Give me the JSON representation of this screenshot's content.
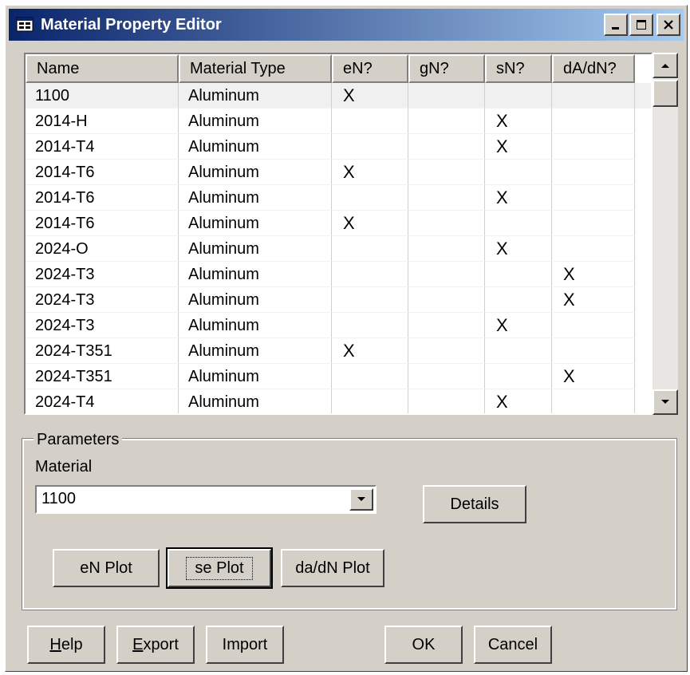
{
  "window": {
    "title": "Material Property Editor"
  },
  "table": {
    "columns": [
      "Name",
      "Material Type",
      "eN?",
      "gN?",
      "sN?",
      "dA/dN?"
    ],
    "rows": [
      [
        "1100",
        "Aluminum",
        "X",
        "",
        "",
        ""
      ],
      [
        "2014-H",
        "Aluminum",
        "",
        "",
        "X",
        ""
      ],
      [
        "2014-T4",
        "Aluminum",
        "",
        "",
        "X",
        ""
      ],
      [
        "2014-T6",
        "Aluminum",
        "X",
        "",
        "",
        ""
      ],
      [
        "2014-T6",
        "Aluminum",
        "",
        "",
        "X",
        ""
      ],
      [
        "2014-T6",
        "Aluminum",
        "X",
        "",
        "",
        ""
      ],
      [
        "2024-O",
        "Aluminum",
        "",
        "",
        "X",
        ""
      ],
      [
        "2024-T3",
        "Aluminum",
        "",
        "",
        "",
        "X"
      ],
      [
        "2024-T3",
        "Aluminum",
        "",
        "",
        "",
        "X"
      ],
      [
        "2024-T3",
        "Aluminum",
        "",
        "",
        "X",
        ""
      ],
      [
        "2024-T351",
        "Aluminum",
        "X",
        "",
        "",
        ""
      ],
      [
        "2024-T351",
        "Aluminum",
        "",
        "",
        "",
        "X"
      ],
      [
        "2024-T4",
        "Aluminum",
        "",
        "",
        "X",
        ""
      ]
    ]
  },
  "parameters": {
    "legend": "Parameters",
    "material_label": "Material",
    "material_value": "1100",
    "details_label": "Details",
    "en_plot_label": "eN Plot",
    "se_plot_label": "se Plot",
    "dadn_plot_label": "da/dN Plot"
  },
  "footer": {
    "help_rest": "elp",
    "help_key": "H",
    "export_key": "E",
    "export_rest": "xport",
    "import_label": "Import",
    "ok_label": "OK",
    "cancel_label": "Cancel"
  }
}
